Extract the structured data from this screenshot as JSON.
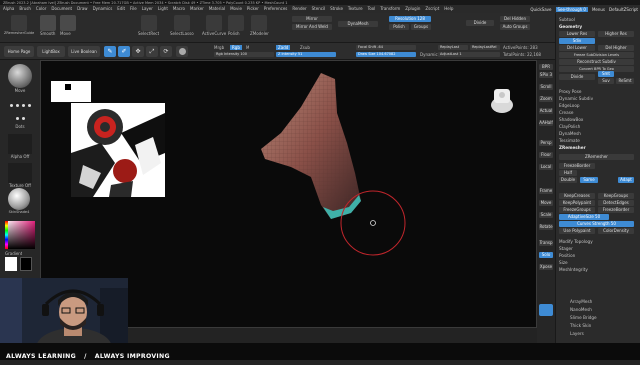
{
  "titlebar": {
    "text": "ZBrush 2023.2 [Abraham Ivel]   ZBrush Document    • Free Mem 20.717GB • Active Mem 2034 • Scratch Disk 49 • ZTime 3.705 • PolyCount 0.235 KP • MeshCount 1"
  },
  "menu": [
    "Alpha",
    "Brush",
    "Color",
    "Document",
    "Draw",
    "Dynamics",
    "Edit",
    "File",
    "Layer",
    "Light",
    "Macro",
    "Marker",
    "Material",
    "Movie",
    "Picker",
    "Preferences",
    "Render",
    "Stencil",
    "Stroke",
    "Texture",
    "Tool",
    "Transform",
    "Zplugin",
    "Zscript",
    "Help"
  ],
  "topright": {
    "quicksave": "QuickSave",
    "seethrough": "See-through 0",
    "menus": "Menus",
    "script": "DefaultZScript"
  },
  "shelf": {
    "items": [
      "ZRemesherGuide",
      "Smooth",
      "Move",
      "SelectRect",
      "SelectLasso",
      "ActiveCurve",
      "Polish",
      "ZModeler"
    ],
    "mirror": "Mirror",
    "mirror_weld": "Mirror And Weld",
    "dynamesh": "DynaMesh",
    "resolution": "Resolution 128",
    "polish": "Polish",
    "groups": "Groups",
    "divide": "Divide",
    "del_hidden": "Del Hidden",
    "auto_groups": "Auto Groups"
  },
  "toolrow": {
    "home": "Home Page",
    "lightbox": "LightBox",
    "livebool": "Live Boolean",
    "edit": "Edit",
    "draw": "Draw",
    "move": "Move",
    "scale": "Scale",
    "rotate": "Rotate",
    "mrgb": "Mrgb",
    "rgb": "Rgb",
    "m": "M",
    "zadd": "Zadd",
    "zsub": "Zsub",
    "rgb_intensity": "Rgb Intensity 100",
    "z_intensity": "Z Intensity 51",
    "focal_shift": "Focal Shift -64",
    "draw_size": "Draw Size 104.67082",
    "dynamic": "Dynamic",
    "replay_last": "ReplayLast",
    "replay_last_rel": "ReplayLastRel",
    "adjust_last": "AdjustLast 1",
    "active_points": "ActivePoints: 283",
    "total_points": "TotalPoints: 22,168"
  },
  "leftshelf": {
    "brush": "Move",
    "stroke": "Dots",
    "alpha": "Alpha Off",
    "texture": "Texture Off",
    "material": "SkinShade4",
    "gradient": "Gradient",
    "switch": "SwitchColor",
    "alternate": "Alternate"
  },
  "rightshelf": [
    "BPR",
    "SPix 3",
    "Scroll",
    "Zoom",
    "Actual",
    "AAHalf",
    "Persp",
    "Floor",
    "Local",
    "Frame",
    "Move",
    "Scale",
    "Rotate",
    "Transp",
    "Solo",
    "Xpose"
  ],
  "tray": {
    "header": [
      "Subtool",
      "Geometry"
    ],
    "rows1": [
      "Lower Res",
      "Higher Res",
      "Sdiv",
      "Del Lower",
      "Del Higher",
      "Freeze SubDivision Levels",
      "Reconstruct Subdiv",
      "Convert BPR To Geo"
    ],
    "divide": "Divide",
    "smt": "Smt",
    "suv": "Suv",
    "rsmt": "ReSmt",
    "rows2": [
      "Proxy Pose",
      "Dynamic Subdiv",
      "EdgeLoop",
      "Crease",
      "ShadowBox",
      "ClayPolish",
      "DynaMesh",
      "Tessimate",
      "ZRemesher"
    ],
    "zremesher_btn": "ZRemesher",
    "freeze_border": "FreezeBorder",
    "half": "Half",
    "same": "Same",
    "double": "Double",
    "adapt": "Adapt",
    "keep_creases": "KeepCreases",
    "keep_groups": "KeepGroups",
    "keep_polypaint": "KeepPolypaint",
    "detect_edges": "DetectEdges",
    "freeze_groups": "FreezeGroups",
    "smooth_normals": "FreezeBorder",
    "adaptive_size": "AdaptiveSize 50",
    "curves_strength": "Curves Strength 50",
    "use_polypaint": "Use Polypaint",
    "color_density": "ColorDensity",
    "rows3": [
      "Modify Topology",
      "Stager",
      "Position",
      "Size",
      "MeshIntegrity"
    ],
    "rows4": [
      "ArrayMesh",
      "NanoMesh",
      "Slime Bridge",
      "Thick Skin",
      "Layers"
    ]
  },
  "banner": {
    "left": "ALWAYS LEARNING",
    "right": "ALWAYS IMPROVING"
  },
  "colors": {
    "accent": "#3e8bd4",
    "banner_bg": "#0b0b0b",
    "mesh": "#8a5048",
    "mesh_edge": "#3fb0a8",
    "cursor": "#c0262c"
  }
}
